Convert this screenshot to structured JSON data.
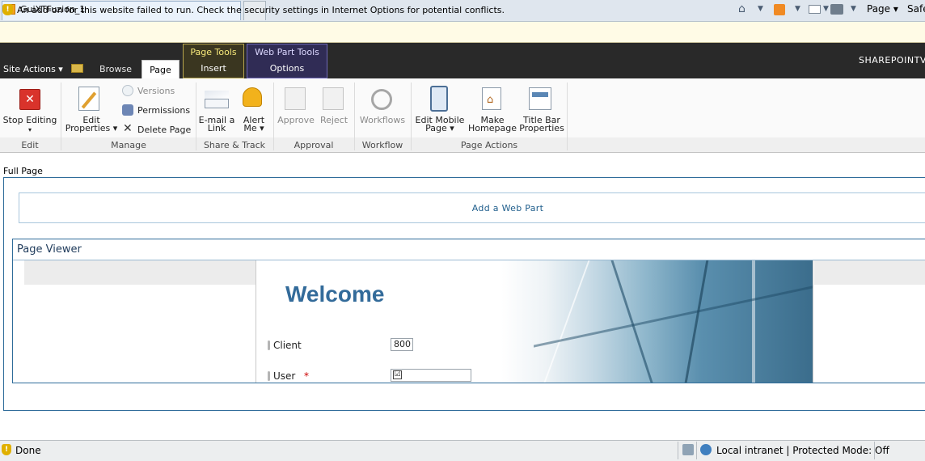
{
  "browser": {
    "tab_title": "GuiXTFuzion_1",
    "command_bar": {
      "page_label": "Page ▾",
      "safety_label": "Safe"
    },
    "info_bar_text": "An add-on for this website failed to run. Check the security settings in Internet Options for potential conflicts.",
    "status": {
      "text": "Done",
      "zone": "Local intranet | Protected Mode: Off"
    }
  },
  "ribbon": {
    "site_actions": "Site Actions ▾",
    "tabs": {
      "browse": "Browse",
      "page": "Page",
      "insert": "Insert",
      "options": "Options"
    },
    "context_groups": {
      "page_tools": "Page Tools",
      "web_part_tools": "Web Part Tools"
    },
    "site_name": "SHAREPOINTV",
    "groups": {
      "edit": {
        "label": "Edit",
        "stop_editing": "Stop Editing",
        "stop_editing_arrow": "▾"
      },
      "manage": {
        "label": "Manage",
        "edit_properties_1": "Edit",
        "edit_properties_2": "Properties ▾",
        "versions": "Versions",
        "permissions": "Permissions",
        "delete_page": "Delete Page"
      },
      "share_track": {
        "label": "Share & Track",
        "email_link_1": "E-mail a",
        "email_link_2": "Link",
        "alert_me_1": "Alert",
        "alert_me_2": "Me ▾"
      },
      "approval": {
        "label": "Approval",
        "approve": "Approve",
        "reject": "Reject"
      },
      "workflow": {
        "label": "Workflow",
        "workflows": "Workflows"
      },
      "page_actions": {
        "label": "Page Actions",
        "edit_mobile_1": "Edit Mobile",
        "edit_mobile_2": "Page ▾",
        "make_homepage_1": "Make",
        "make_homepage_2": "Homepage",
        "title_bar_1": "Title Bar",
        "title_bar_2": "Properties"
      }
    }
  },
  "page": {
    "zone_label": "Full Page",
    "add_web_part": "Add a Web Part",
    "web_part_title": "Page Viewer",
    "frame": {
      "welcome": "Welcome",
      "client_label": "Client",
      "client_value": "800",
      "user_label": "User",
      "required_marker": "*",
      "user_check": "☑"
    }
  },
  "colors": {
    "ribbon_dark": "#292929",
    "page_tools_accent": "#b7a54d",
    "web_part_tools_accent": "#6f68b8",
    "link_blue": "#1f5e8c",
    "welcome_blue": "#336b9a"
  }
}
